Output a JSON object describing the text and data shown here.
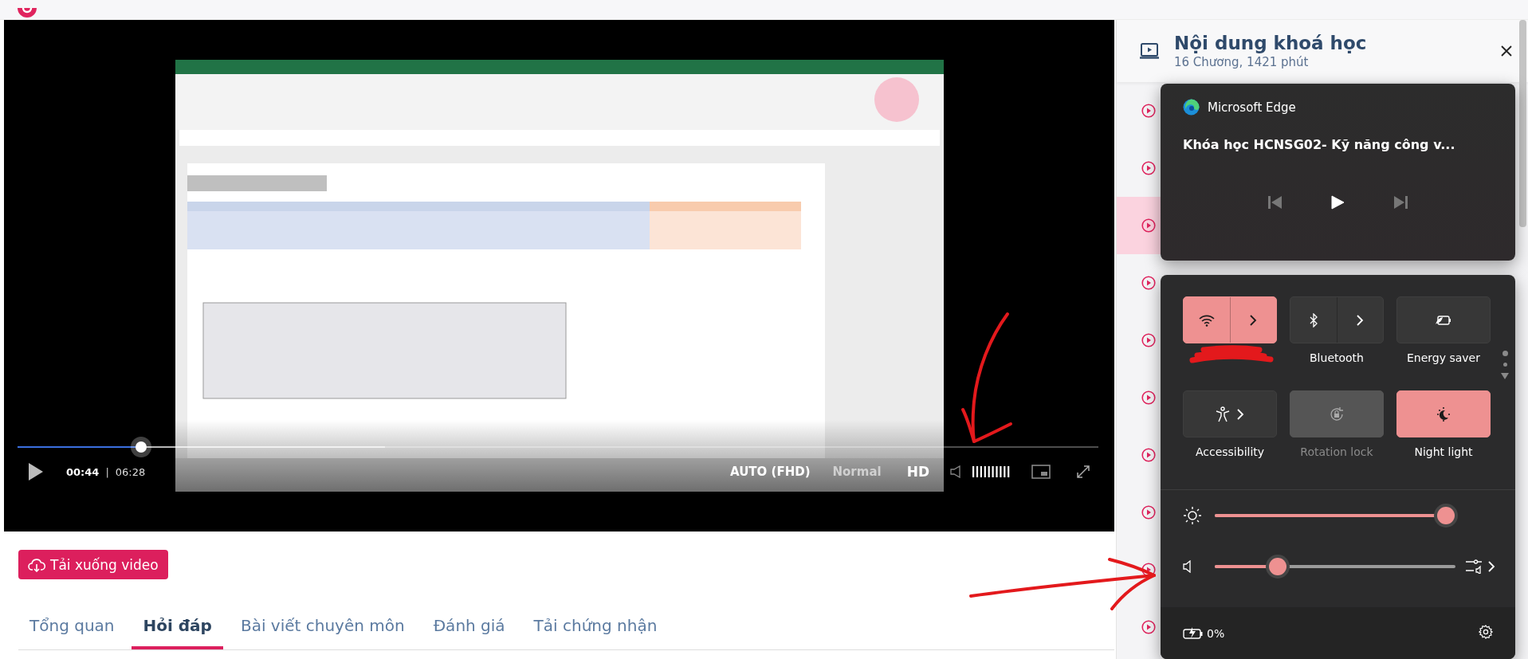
{
  "video_player": {
    "progress": {
      "level": 0.114
    },
    "current_time": "00:44",
    "time_separator": "|",
    "duration": "06:28",
    "quality": "AUTO (FHD)",
    "speed": "Normal",
    "hd_badge": "HD"
  },
  "download_button": {
    "label": "Tải xuống video"
  },
  "tabs": [
    {
      "label": "Tổng quan",
      "selected": false
    },
    {
      "label": "Hỏi đáp",
      "selected": true
    },
    {
      "label": "Bài viết chuyên môn",
      "selected": false
    },
    {
      "label": "Đánh giá",
      "selected": false
    },
    {
      "label": "Tải chứng nhận",
      "selected": false
    }
  ],
  "course_panel": {
    "title": "Nội dung khoá học",
    "subtitle": "16 Chương, 1421 phút",
    "lessons": [
      {
        "selected": false
      },
      {
        "selected": false
      },
      {
        "selected": true
      },
      {
        "selected": false
      },
      {
        "selected": false
      },
      {
        "selected": false
      },
      {
        "selected": false
      },
      {
        "selected": false
      },
      {
        "selected": false
      },
      {
        "selected": false
      }
    ]
  },
  "media_flyout": {
    "app": "Microsoft Edge",
    "title": "Khóa học HCNSG02- Kỹ năng công v..."
  },
  "quick_settings": {
    "tiles": [
      {
        "kind": "wifi",
        "on": true,
        "expandable": true,
        "disabled": false
      },
      {
        "kind": "bluetooth",
        "label": "Bluetooth",
        "on": false,
        "expandable": true,
        "disabled": false
      },
      {
        "kind": "energy",
        "label": "Energy saver",
        "on": false,
        "expandable": false,
        "disabled": false
      },
      {
        "kind": "accessibility",
        "label": "Accessibility",
        "on": false,
        "expandable": true,
        "disabled": false
      },
      {
        "kind": "rotation",
        "label": "Rotation lock",
        "on": false,
        "expandable": false,
        "disabled": true
      },
      {
        "kind": "nightlight",
        "label": "Night light",
        "on": true,
        "expandable": false,
        "disabled": false
      }
    ],
    "brightness": {
      "level": 0.96
    },
    "volume": {
      "level": 0.26
    },
    "battery": "0%"
  }
}
